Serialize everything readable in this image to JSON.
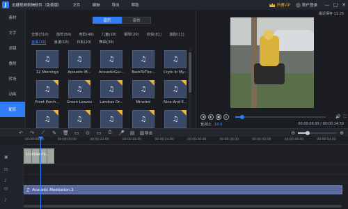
{
  "app": {
    "title": "迅捷视频剪辑软件（免费版）",
    "logo_text": "J",
    "menu": [
      "文件",
      "编辑",
      "导出",
      "帮助"
    ],
    "vip_label": "开通VIP",
    "login_label": "账户登录",
    "win_buttons": [
      "—",
      "□",
      "✕"
    ]
  },
  "sidebar": {
    "items": [
      {
        "label": "素材",
        "active": false
      },
      {
        "label": "文字",
        "active": false
      },
      {
        "label": "滤镜",
        "active": false
      },
      {
        "label": "叠附",
        "active": false
      },
      {
        "label": "转场",
        "active": false
      },
      {
        "label": "动画",
        "active": false
      },
      {
        "label": "配乐",
        "active": true
      }
    ]
  },
  "library": {
    "tabs": [
      {
        "label": "音乐",
        "active": true
      },
      {
        "label": "音效",
        "active": false
      }
    ],
    "categories_row1": [
      "全部(310)",
      "悠然(58)",
      "电影(48)",
      "儿童(18)",
      "钢琴(20)",
      "欢快(81)",
      "激励(11)"
    ],
    "categories_row2": [
      "金曲(18)",
      "浪漫(18)",
      "日系(20)",
      "舞曲(38)"
    ],
    "active_category": "金曲(18)",
    "items": [
      {
        "label": "12 Mornings",
        "premium": false
      },
      {
        "label": "Acoustic M...",
        "premium": false
      },
      {
        "label": "AcousticGui...",
        "premium": false
      },
      {
        "label": "BackToThe...",
        "premium": false
      },
      {
        "label": "Cryin In My...",
        "premium": false
      },
      {
        "label": "Front Porch...",
        "premium": true
      },
      {
        "label": "Green Leaves",
        "premium": true
      },
      {
        "label": "Landras Dr...",
        "premium": true
      },
      {
        "label": "Minstrel",
        "premium": true
      },
      {
        "label": "Nice And E...",
        "premium": true
      },
      {
        "label": "",
        "premium": true
      },
      {
        "label": "",
        "premium": true
      },
      {
        "label": "",
        "premium": true
      },
      {
        "label": "",
        "premium": true
      },
      {
        "label": "",
        "premium": true
      }
    ],
    "scroll_position": 0.05
  },
  "preview": {
    "clock": "最近保存 11:25",
    "control_icons": [
      "◀",
      "▶",
      "■",
      "▸"
    ],
    "right_icons": [
      "🔊",
      "⛶"
    ],
    "progress": 0.08,
    "aspect_label": "宽高比：",
    "aspect_value": "16:9",
    "timecode": "00:00:06.93 / 00:00:14.59"
  },
  "toolbar": {
    "icons": [
      "↶",
      "↷",
      "⟋",
      "✎",
      "🗑",
      "▭",
      "⊙",
      "▭",
      "⏱",
      "🎤",
      "▤",
      "▥"
    ],
    "export_label": "导出",
    "zoom_out": "⊖",
    "zoom_in": "⊕",
    "zoom_level": 0.25
  },
  "timeline": {
    "ticks": [
      "00:00:00.00",
      "00:00:06.00",
      "00:00:12.00",
      "00:00:18.00",
      "00:00:24.00",
      "00:00:30.00",
      "00:00:36.00",
      "00:00:42.00",
      "00:00:48.00",
      "00:00:54.00"
    ],
    "video_clip_name": "1539598078...",
    "audio_clip_name": "Acoustic Meditation 2",
    "audio_icon": "♫",
    "track_icons": [
      "▣",
      "⊡",
      "♪",
      "⊡",
      "♪"
    ]
  }
}
